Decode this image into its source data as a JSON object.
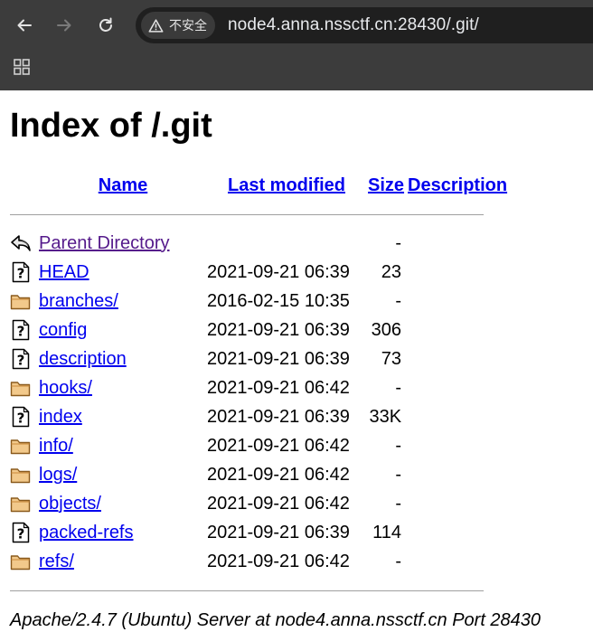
{
  "browser": {
    "security_label": "不安全",
    "url": "node4.anna.nssctf.cn:28430/.git/",
    "icons": {
      "back": "back-arrow-icon",
      "forward": "forward-arrow-icon",
      "reload": "reload-icon",
      "warning": "warning-triangle-icon",
      "apps": "apps-grid-icon"
    }
  },
  "page": {
    "title": "Index of /.git",
    "columns": {
      "name": "Name",
      "last_modified": "Last modified",
      "size": "Size",
      "description": "Description"
    },
    "parent": {
      "name": "Parent Directory",
      "size": "-",
      "icon": "back-arrow-icon"
    },
    "entries": [
      {
        "name": "HEAD",
        "modified": "2021-09-21 06:39",
        "size": "23",
        "icon": "unknown-file-icon"
      },
      {
        "name": "branches/",
        "modified": "2016-02-15 10:35",
        "size": "-",
        "icon": "folder-icon"
      },
      {
        "name": "config",
        "modified": "2021-09-21 06:39",
        "size": "306",
        "icon": "unknown-file-icon"
      },
      {
        "name": "description",
        "modified": "2021-09-21 06:39",
        "size": "73",
        "icon": "unknown-file-icon"
      },
      {
        "name": "hooks/",
        "modified": "2021-09-21 06:42",
        "size": "-",
        "icon": "folder-icon"
      },
      {
        "name": "index",
        "modified": "2021-09-21 06:39",
        "size": "33K",
        "icon": "unknown-file-icon"
      },
      {
        "name": "info/",
        "modified": "2021-09-21 06:42",
        "size": "-",
        "icon": "folder-icon"
      },
      {
        "name": "logs/",
        "modified": "2021-09-21 06:42",
        "size": "-",
        "icon": "folder-icon"
      },
      {
        "name": "objects/",
        "modified": "2021-09-21 06:42",
        "size": "-",
        "icon": "folder-icon"
      },
      {
        "name": "packed-refs",
        "modified": "2021-09-21 06:39",
        "size": "114",
        "icon": "unknown-file-icon"
      },
      {
        "name": "refs/",
        "modified": "2021-09-21 06:42",
        "size": "-",
        "icon": "folder-icon"
      }
    ],
    "footer": "Apache/2.4.7 (Ubuntu) Server at node4.anna.nssctf.cn Port 28430"
  },
  "colors": {
    "chrome_bg": "#3c3c3c",
    "omnibox_bg": "#1f1f1f",
    "link": "#0000ee",
    "visited_link": "#551a8b"
  }
}
